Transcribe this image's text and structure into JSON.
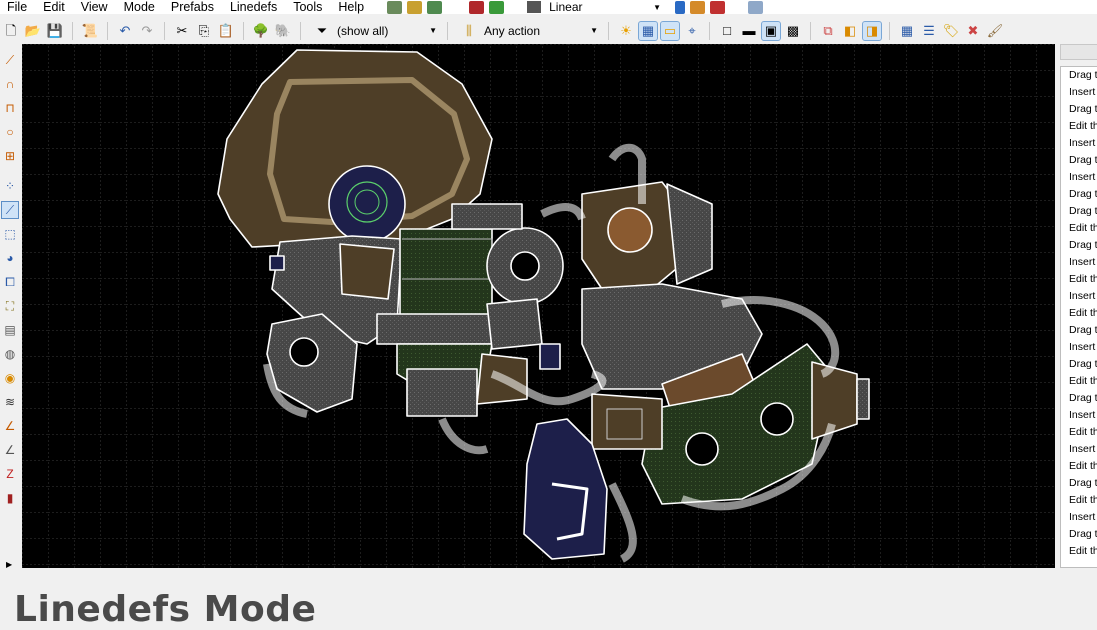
{
  "menu": [
    "File",
    "Edit",
    "View",
    "Mode",
    "Prefabs",
    "Linedefs",
    "Tools",
    "Help"
  ],
  "mode_selector": {
    "value": "Linear"
  },
  "toolbar": {
    "filter": {
      "label": "(show all)"
    },
    "action": {
      "label": "Any action"
    }
  },
  "right_panel": {
    "hints": [
      "Drag t",
      "Insert",
      "Drag t",
      "Edit th",
      "Insert",
      "Drag t",
      "Insert",
      "Drag t",
      "Drag t",
      "Edit th",
      "Drag t",
      "Insert",
      "Edit th",
      "Insert",
      "Edit th",
      "Drag t",
      "Insert",
      "Drag t",
      "Edit th",
      "Drag t",
      "Insert",
      "Edit th",
      "Insert",
      "Edit th",
      "Drag t",
      "Edit th",
      "Insert",
      "Drag t",
      "Edit th"
    ]
  },
  "page": {
    "title": "Linedefs Mode"
  },
  "colors": {
    "canvas": "#000000",
    "grid": "#3c3c3c",
    "sector_brown": "#4e3e27",
    "sector_green": "#263a1f",
    "sector_gray": "#4a4a4a",
    "sector_blue": "#1d1f4a",
    "line": "#ffffff"
  },
  "icons": {
    "toolbar": [
      "new-icon",
      "open-icon",
      "save-icon",
      "script-icon",
      "undo-icon",
      "redo-icon",
      "cut-icon",
      "copy-icon",
      "paste-icon",
      "tree-icon",
      "elephant-icon",
      "filter-icon",
      "action-icon",
      "light-icon",
      "grid-icon",
      "comment-icon",
      "snap-icon",
      "square-icon",
      "rect-icon",
      "texture-icon",
      "preview-icon",
      "select-icon",
      "merge-icon",
      "copy-props-icon",
      "grid-setup-icon",
      "list-icon",
      "tag-icon",
      "flip-icon",
      "brush-icon"
    ],
    "left": [
      "draw-line-icon",
      "curve-icon",
      "bracket-icon",
      "circle-icon",
      "ladder-icon",
      "vertices-icon",
      "linedefs-icon",
      "sectors-icon",
      "things-icon",
      "make-sector-icon",
      "visual-mode-icon",
      "map-icon",
      "sound-icon",
      "layers-icon",
      "angle-icon",
      "slope-icon",
      "zdoom-icon",
      "script-icon"
    ]
  }
}
